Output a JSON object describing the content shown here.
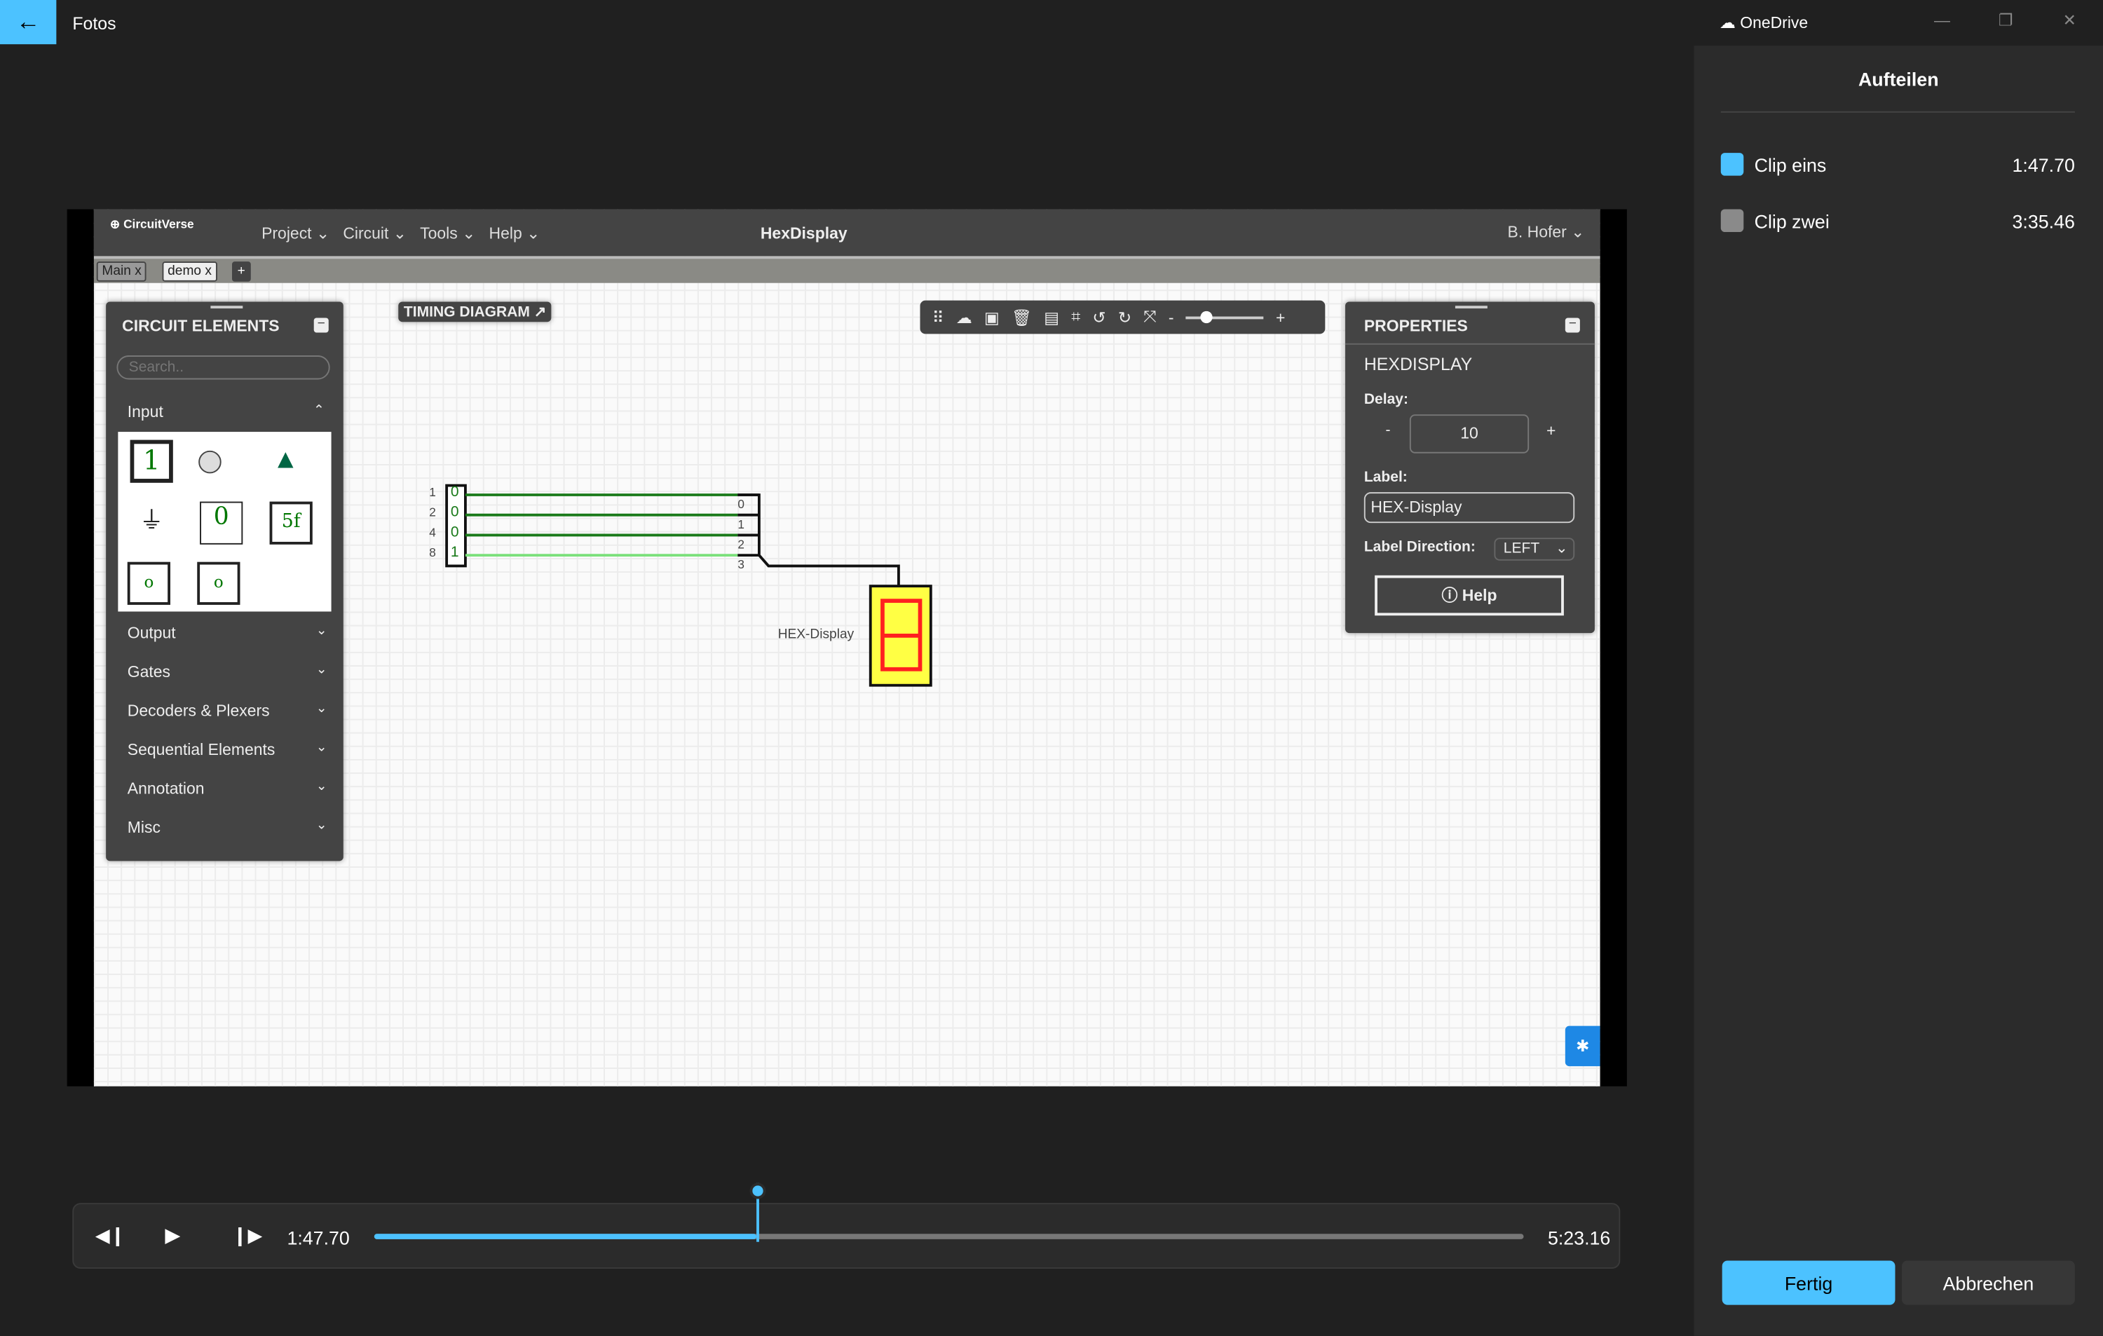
{
  "app": {
    "title": "Fotos",
    "back_icon": "arrow-left-icon"
  },
  "window": {
    "account": "OneDrive",
    "minimize": "—",
    "restore": "❐",
    "close": "✕"
  },
  "circuitverse": {
    "logo": "CircuitVerse",
    "menu": [
      "Project",
      "Circuit",
      "Tools",
      "Help"
    ],
    "project_title": "HexDisplay",
    "user": "B. Hofer",
    "tabs": [
      {
        "label": "Main",
        "close": "x"
      },
      {
        "label": "demo",
        "close": "x"
      }
    ],
    "add_tab": "+",
    "timing_diagram": "TIMING DIAGRAM",
    "elements_panel": {
      "title": "CIRCUIT ELEMENTS",
      "search_placeholder": "Search..",
      "input_label": "Input",
      "categories": [
        "Output",
        "Gates",
        "Decoders & Plexers",
        "Sequential Elements",
        "Annotation",
        "Misc"
      ],
      "input_items": {
        "constant": "1",
        "const_out": "0",
        "hex": "5f",
        "clock_a": "o",
        "clock_b": "o"
      }
    },
    "zoom_minus": "-",
    "zoom_plus": "+",
    "zoom_level": 0.25,
    "properties": {
      "title": "PROPERTIES",
      "element": "HEXDISPLAY",
      "delay_label": "Delay:",
      "delay_value": "10",
      "minus": "-",
      "plus": "+",
      "label_label": "Label:",
      "label_value": "HEX-Display",
      "direction_label": "Label Direction:",
      "direction_value": "LEFT",
      "help": "Help"
    },
    "circuit": {
      "input_weights": [
        "1",
        "2",
        "4",
        "8"
      ],
      "input_values": [
        "0",
        "0",
        "0",
        "1"
      ],
      "splitter_labels": [
        "0",
        "1",
        "2",
        "3"
      ],
      "display_label": "HEX-Display"
    }
  },
  "player": {
    "current_time": "1:47.70",
    "total_time": "5:23.16",
    "progress": 0.333
  },
  "sidebar": {
    "title": "Aufteilen",
    "clips": [
      {
        "name": "Clip eins",
        "time": "1:47.70",
        "color": "#4cc2ff"
      },
      {
        "name": "Clip zwei",
        "time": "3:35.46",
        "color": "#8a8a8a"
      }
    ],
    "done": "Fertig",
    "cancel": "Abbrechen"
  },
  "colors": {
    "accent": "#4cc2ff",
    "wire_on": "#1a7a1a",
    "wire_high": "#7be07b",
    "display_bg": "#ffff44",
    "segment": "#ff2020"
  }
}
